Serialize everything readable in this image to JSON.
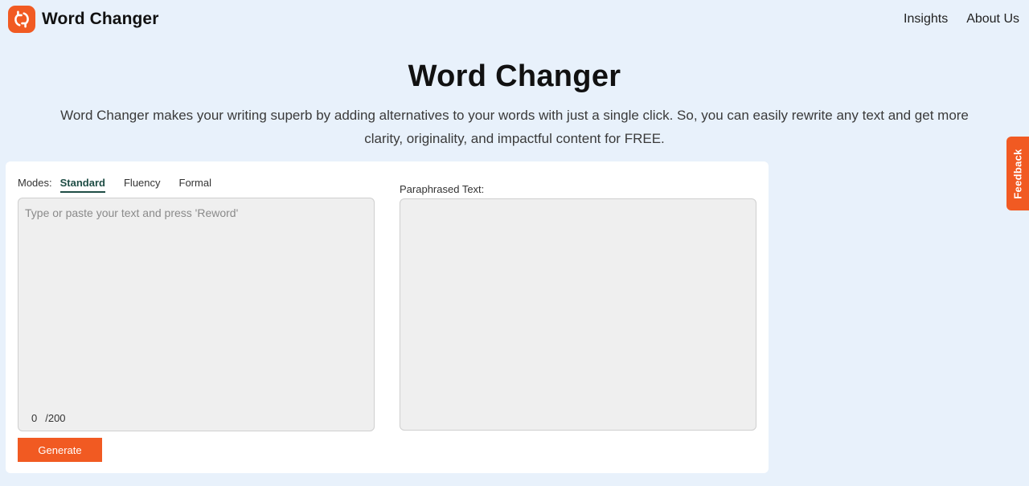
{
  "brand": {
    "name": "Word Changer",
    "accent_color": "#f15a22",
    "logo_icon": "refresh-arrows-icon"
  },
  "nav": {
    "items": [
      {
        "label": "Insights"
      },
      {
        "label": "About Us"
      }
    ]
  },
  "hero": {
    "title": "Word Changer",
    "description": "Word Changer makes your writing superb by adding alternatives to your words with just a single click. So, you can easily rewrite any text and get more clarity, originality, and impactful content for FREE."
  },
  "tool": {
    "modes_label": "Modes:",
    "modes": [
      {
        "label": "Standard",
        "active": true
      },
      {
        "label": "Fluency",
        "active": false
      },
      {
        "label": "Formal",
        "active": false
      }
    ],
    "input": {
      "value": "",
      "placeholder": "Type or paste your text and press 'Reword'"
    },
    "counter": {
      "count": "0",
      "limit": "/200"
    },
    "generate_label": "Generate",
    "output_label": "Paraphrased Text:"
  },
  "feedback": {
    "label": "Feedback"
  }
}
